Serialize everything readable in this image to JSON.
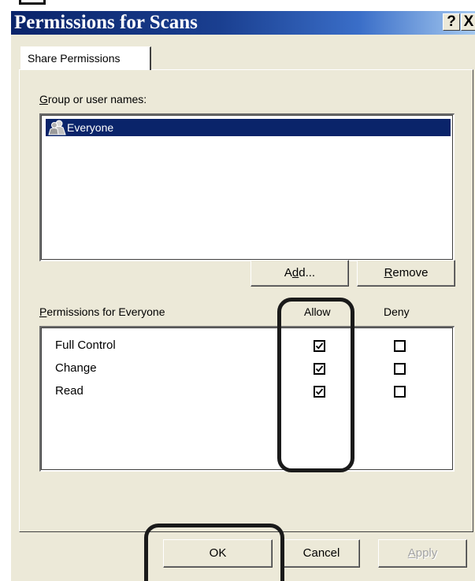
{
  "window": {
    "title": "Permissions for Scans",
    "help_button": "?",
    "close_button": "X"
  },
  "tabs": [
    {
      "label": "Share Permissions"
    }
  ],
  "group_section": {
    "label_prefix": "",
    "label_accel": "G",
    "label_rest": "roup or user names:",
    "items": [
      {
        "label": "Everyone",
        "icon": "users-icon",
        "selected": true
      }
    ]
  },
  "buttons": {
    "add": {
      "pre": "A",
      "accel": "d",
      "post": "d..."
    },
    "remove": {
      "accel": "R",
      "post": "emove"
    },
    "ok": "OK",
    "cancel": "Cancel",
    "apply": {
      "accel": "A",
      "post": "pply"
    }
  },
  "permissions": {
    "label_accel": "P",
    "label_rest": "ermissions for Everyone",
    "col_allow": "Allow",
    "col_deny": "Deny",
    "rows": [
      {
        "name": "Full Control",
        "allow": true,
        "deny": false
      },
      {
        "name": "Change",
        "allow": true,
        "deny": false
      },
      {
        "name": "Read",
        "allow": true,
        "deny": false
      }
    ]
  },
  "colors": {
    "title_bar_start": "#0a246a",
    "selection": "#0a246a",
    "dialog_face": "#ece9d8"
  }
}
